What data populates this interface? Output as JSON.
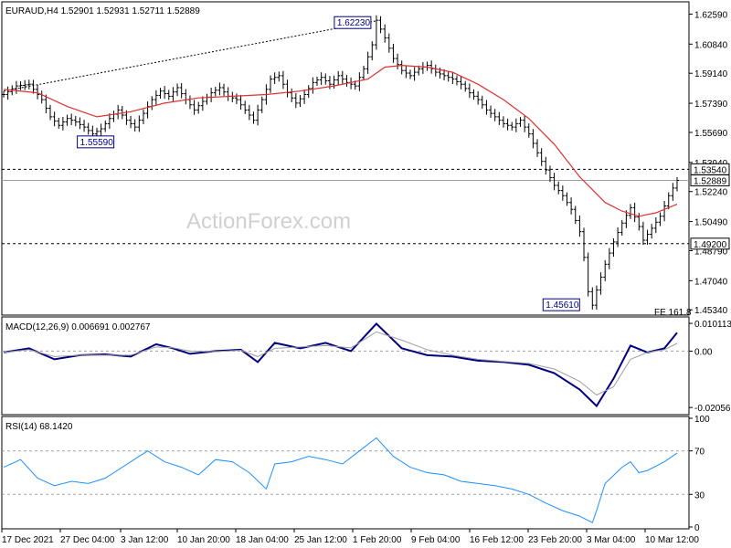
{
  "symbol_header": "EURAUD,H4  1.52901  1.52931  1.52711  1.52889",
  "watermark": "ActionForex.com",
  "colors": {
    "price_bars": "#000000",
    "ma_line": "#e03030",
    "macd_line": "#000080",
    "macd_signal": "#a0a0a0",
    "rsi_line": "#1e90ff",
    "level_line": "#000000",
    "trend_line": "#000000"
  },
  "chart_data": [
    {
      "type": "ohlc",
      "title": "EURAUD,H4  1.52901  1.52931  1.52711  1.52889",
      "ylim": [
        1.4514,
        1.632
      ],
      "y_ticks": [
        1.6259,
        1.6084,
        1.5914,
        1.5739,
        1.5569,
        1.5394,
        1.5224,
        1.5049,
        1.4879,
        1.4704,
        1.4534
      ],
      "y_tick_labels": [
        "1.62590",
        "1.60840",
        "1.59140",
        "1.57390",
        "1.55690",
        "1.53940",
        "1.52240",
        "1.50490",
        "1.48790",
        "1.47040",
        "1.45340"
      ],
      "x_tick_labels": [
        "17 Dec 2021",
        "27 Dec 04:00",
        "3 Jan 12:00",
        "10 Jan 20:00",
        "18 Jan 04:00",
        "25 Jan 12:00",
        "1 Feb 20:00",
        "9 Feb 04:00",
        "16 Feb 12:00",
        "23 Feb 20:00",
        "3 Mar 04:00",
        "10 Mar 12:00"
      ],
      "close_path": [
        [
          0,
          1.579
        ],
        [
          3,
          1.584
        ],
        [
          6,
          1.585
        ],
        [
          9,
          1.576
        ],
        [
          11,
          1.566
        ],
        [
          13,
          1.561
        ],
        [
          15,
          1.565
        ],
        [
          17,
          1.563
        ],
        [
          19,
          1.56
        ],
        [
          21,
          1.556
        ],
        [
          23,
          1.559
        ],
        [
          25,
          1.565
        ],
        [
          27,
          1.57
        ],
        [
          29,
          1.564
        ],
        [
          31,
          1.56
        ],
        [
          33,
          1.568
        ],
        [
          35,
          1.576
        ],
        [
          37,
          1.581
        ],
        [
          39,
          1.578
        ],
        [
          41,
          1.583
        ],
        [
          43,
          1.576
        ],
        [
          45,
          1.57
        ],
        [
          47,
          1.575
        ],
        [
          49,
          1.58
        ],
        [
          51,
          1.583
        ],
        [
          53,
          1.578
        ],
        [
          55,
          1.576
        ],
        [
          57,
          1.57
        ],
        [
          59,
          1.564
        ],
        [
          61,
          1.576
        ],
        [
          63,
          1.588
        ],
        [
          65,
          1.59
        ],
        [
          67,
          1.58
        ],
        [
          69,
          1.574
        ],
        [
          71,
          1.579
        ],
        [
          73,
          1.586
        ],
        [
          75,
          1.589
        ],
        [
          77,
          1.585
        ],
        [
          79,
          1.59
        ],
        [
          81,
          1.586
        ],
        [
          83,
          1.584
        ],
        [
          85,
          1.594
        ],
        [
          87,
          1.608
        ],
        [
          88,
          1.6223
        ],
        [
          90,
          1.612
        ],
        [
          92,
          1.6
        ],
        [
          94,
          1.593
        ],
        [
          96,
          1.59
        ],
        [
          98,
          1.594
        ],
        [
          100,
          1.596
        ],
        [
          102,
          1.592
        ],
        [
          104,
          1.59
        ],
        [
          106,
          1.588
        ],
        [
          108,
          1.585
        ],
        [
          110,
          1.58
        ],
        [
          112,
          1.576
        ],
        [
          114,
          1.57
        ],
        [
          116,
          1.566
        ],
        [
          118,
          1.562
        ],
        [
          120,
          1.56
        ],
        [
          122,
          1.564
        ],
        [
          124,
          1.556
        ],
        [
          126,
          1.545
        ],
        [
          128,
          1.535
        ],
        [
          130,
          1.526
        ],
        [
          132,
          1.52
        ],
        [
          134,
          1.512
        ],
        [
          136,
          1.499
        ],
        [
          137,
          1.484
        ],
        [
          138,
          1.464
        ],
        [
          139,
          1.4561
        ],
        [
          140,
          1.465
        ],
        [
          142,
          1.48
        ],
        [
          144,
          1.493
        ],
        [
          146,
          1.504
        ],
        [
          148,
          1.513
        ],
        [
          150,
          1.502
        ],
        [
          151,
          1.494
        ],
        [
          153,
          1.501
        ],
        [
          155,
          1.508
        ],
        [
          157,
          1.52
        ],
        [
          159,
          1.5289
        ]
      ],
      "ma_path": [
        [
          0,
          1.582
        ],
        [
          8,
          1.58
        ],
        [
          15,
          1.572
        ],
        [
          22,
          1.566
        ],
        [
          30,
          1.569
        ],
        [
          38,
          1.574
        ],
        [
          46,
          1.577
        ],
        [
          54,
          1.578
        ],
        [
          62,
          1.579
        ],
        [
          70,
          1.581
        ],
        [
          78,
          1.584
        ],
        [
          86,
          1.588
        ],
        [
          90,
          1.595
        ],
        [
          94,
          1.596
        ],
        [
          100,
          1.595
        ],
        [
          106,
          1.592
        ],
        [
          112,
          1.585
        ],
        [
          118,
          1.576
        ],
        [
          124,
          1.565
        ],
        [
          130,
          1.55
        ],
        [
          136,
          1.531
        ],
        [
          142,
          1.516
        ],
        [
          146,
          1.511
        ],
        [
          150,
          1.508
        ],
        [
          154,
          1.51
        ],
        [
          159,
          1.515
        ]
      ],
      "trendline": {
        "x": [
          0,
          88
        ],
        "y": [
          1.581,
          1.622
        ]
      },
      "levels": [
        {
          "value": 1.5354,
          "label": "1.53540",
          "style": "dashed"
        },
        {
          "value": 1.492,
          "label": "1.49200",
          "style": "dashed"
        },
        {
          "value": 1.52889,
          "label": "1.52889",
          "style": "solid"
        }
      ],
      "annotations": [
        {
          "x": 88,
          "y": 1.6223,
          "label": "1.62230"
        },
        {
          "x": 23,
          "y": 1.5559,
          "label": "1.55590"
        },
        {
          "x": 139,
          "y": 1.4561,
          "label": "1.45610"
        }
      ],
      "corner_text": "FE 161.8"
    },
    {
      "type": "line",
      "title": "MACD(12,26,9) 0.006691 0.002767",
      "ylim": [
        -0.0225,
        0.0118
      ],
      "y_ticks": [
        0.010113,
        0.0,
        -0.020561
      ],
      "y_tick_labels": [
        "0.010113",
        "0.00",
        "-0.020561"
      ],
      "series": [
        {
          "role": "macd",
          "values": [
            [
              0,
              -0.0005
            ],
            [
              6,
              0.001
            ],
            [
              12,
              -0.003
            ],
            [
              18,
              -0.0015
            ],
            [
              24,
              -0.0012
            ],
            [
              30,
              -0.002
            ],
            [
              36,
              0.0025
            ],
            [
              40,
              0.001
            ],
            [
              44,
              -0.001
            ],
            [
              50,
              0.0
            ],
            [
              56,
              0.0005
            ],
            [
              60,
              -0.004
            ],
            [
              64,
              0.003
            ],
            [
              70,
              0.001
            ],
            [
              76,
              0.003
            ],
            [
              82,
              0.0
            ],
            [
              88,
              0.01
            ],
            [
              94,
              0.001
            ],
            [
              100,
              -0.0015
            ],
            [
              106,
              -0.002
            ],
            [
              112,
              -0.0035
            ],
            [
              118,
              -0.004
            ],
            [
              124,
              -0.005
            ],
            [
              130,
              -0.008
            ],
            [
              136,
              -0.014
            ],
            [
              140,
              -0.02
            ],
            [
              144,
              -0.01
            ],
            [
              148,
              0.002
            ],
            [
              152,
              -0.0005
            ],
            [
              156,
              0.001
            ],
            [
              159,
              0.0067
            ]
          ]
        },
        {
          "role": "signal",
          "values": [
            [
              0,
              -0.0005
            ],
            [
              6,
              0.0005
            ],
            [
              12,
              -0.002
            ],
            [
              18,
              -0.0015
            ],
            [
              24,
              -0.0015
            ],
            [
              30,
              -0.0015
            ],
            [
              36,
              0.0015
            ],
            [
              40,
              0.0012
            ],
            [
              44,
              0.0
            ],
            [
              50,
              -0.0002
            ],
            [
              56,
              0.0003
            ],
            [
              60,
              -0.002
            ],
            [
              64,
              0.001
            ],
            [
              70,
              0.0015
            ],
            [
              76,
              0.002
            ],
            [
              82,
              0.0012
            ],
            [
              88,
              0.007
            ],
            [
              94,
              0.004
            ],
            [
              100,
              0.0005
            ],
            [
              106,
              -0.0015
            ],
            [
              112,
              -0.003
            ],
            [
              118,
              -0.0038
            ],
            [
              124,
              -0.0045
            ],
            [
              130,
              -0.0065
            ],
            [
              136,
              -0.011
            ],
            [
              140,
              -0.016
            ],
            [
              144,
              -0.013
            ],
            [
              148,
              -0.003
            ],
            [
              152,
              -0.0005
            ],
            [
              156,
              0.0005
            ],
            [
              159,
              0.0028
            ]
          ]
        }
      ]
    },
    {
      "type": "line",
      "title": "RSI(14) 68.1420",
      "ylim": [
        0,
        100
      ],
      "y_ticks": [
        100,
        70,
        30,
        0
      ],
      "y_tick_labels": [
        "100",
        "70",
        "30",
        "0"
      ],
      "reference_levels": [
        70,
        30
      ],
      "series": [
        {
          "role": "rsi",
          "values": [
            [
              0,
              55
            ],
            [
              4,
              62
            ],
            [
              8,
              45
            ],
            [
              12,
              38
            ],
            [
              16,
              42
            ],
            [
              20,
              40
            ],
            [
              24,
              45
            ],
            [
              28,
              55
            ],
            [
              32,
              65
            ],
            [
              34,
              70
            ],
            [
              38,
              60
            ],
            [
              42,
              55
            ],
            [
              46,
              48
            ],
            [
              50,
              62
            ],
            [
              54,
              60
            ],
            [
              58,
              50
            ],
            [
              62,
              35
            ],
            [
              64,
              58
            ],
            [
              68,
              60
            ],
            [
              72,
              65
            ],
            [
              76,
              62
            ],
            [
              80,
              58
            ],
            [
              84,
              70
            ],
            [
              88,
              82
            ],
            [
              92,
              65
            ],
            [
              96,
              55
            ],
            [
              100,
              50
            ],
            [
              104,
              48
            ],
            [
              108,
              42
            ],
            [
              112,
              40
            ],
            [
              116,
              38
            ],
            [
              120,
              35
            ],
            [
              124,
              30
            ],
            [
              128,
              22
            ],
            [
              132,
              15
            ],
            [
              136,
              10
            ],
            [
              139,
              4
            ],
            [
              140,
              15
            ],
            [
              142,
              40
            ],
            [
              146,
              55
            ],
            [
              148,
              60
            ],
            [
              150,
              50
            ],
            [
              152,
              52
            ],
            [
              156,
              60
            ],
            [
              159,
              68
            ]
          ]
        }
      ]
    }
  ]
}
